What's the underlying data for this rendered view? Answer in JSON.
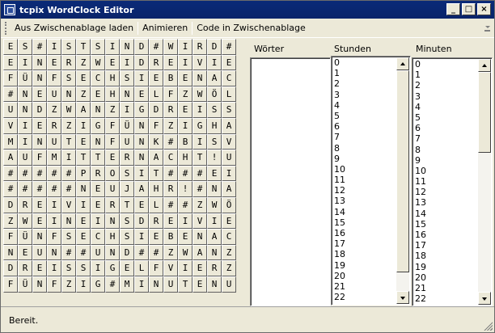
{
  "window": {
    "title": "tcpix WordClock Editor"
  },
  "toolbar": {
    "copy_from_clipboard": "Aus Zwischenablage laden",
    "animate": "Animieren",
    "code_to_clipboard": "Code in Zwischenablage"
  },
  "grid": {
    "rows": [
      "ES#ISTSIND#WIRD#IN",
      "EINERZWEIDREIVIER#",
      "FÜNFSECHSIEBENACHT",
      "#NEUNZEHNELFZWÖLF#",
      "UNDZWANZIGDREISSIG",
      "VIERZIGFÜNFZIGHALB",
      "MINUTENFUNK#BISVOR",
      "AUFMITTERNACHT!UHR",
      "#####PROSIT###EIN",
      "#####NEUJAHR!#NACH",
      "DREIVIERTEL##ZWÖLF",
      "ZWEINEINSDREIVIER#",
      "FÜNFSECHSIEBENACHT",
      "NEUN##UND##ZWANZIG",
      "DREISSIGELFVIERZIG",
      "FÜNFZIG#MINUTENUHR"
    ]
  },
  "lists": {
    "words": {
      "label": "Wörter",
      "items": []
    },
    "hours": {
      "label": "Stunden",
      "items": [
        "0",
        "1",
        "2",
        "3",
        "4",
        "5",
        "6",
        "7",
        "8",
        "9",
        "10",
        "11",
        "12",
        "13",
        "14",
        "15",
        "16",
        "17",
        "18",
        "19",
        "20",
        "21",
        "22"
      ]
    },
    "minutes": {
      "label": "Minuten",
      "items": [
        "0",
        "1",
        "2",
        "3",
        "4",
        "5",
        "6",
        "7",
        "8",
        "9",
        "10",
        "11",
        "12",
        "13",
        "14",
        "15",
        "16",
        "17",
        "18",
        "19",
        "20",
        "21",
        "22"
      ]
    }
  },
  "status": {
    "text": "Bereit."
  }
}
